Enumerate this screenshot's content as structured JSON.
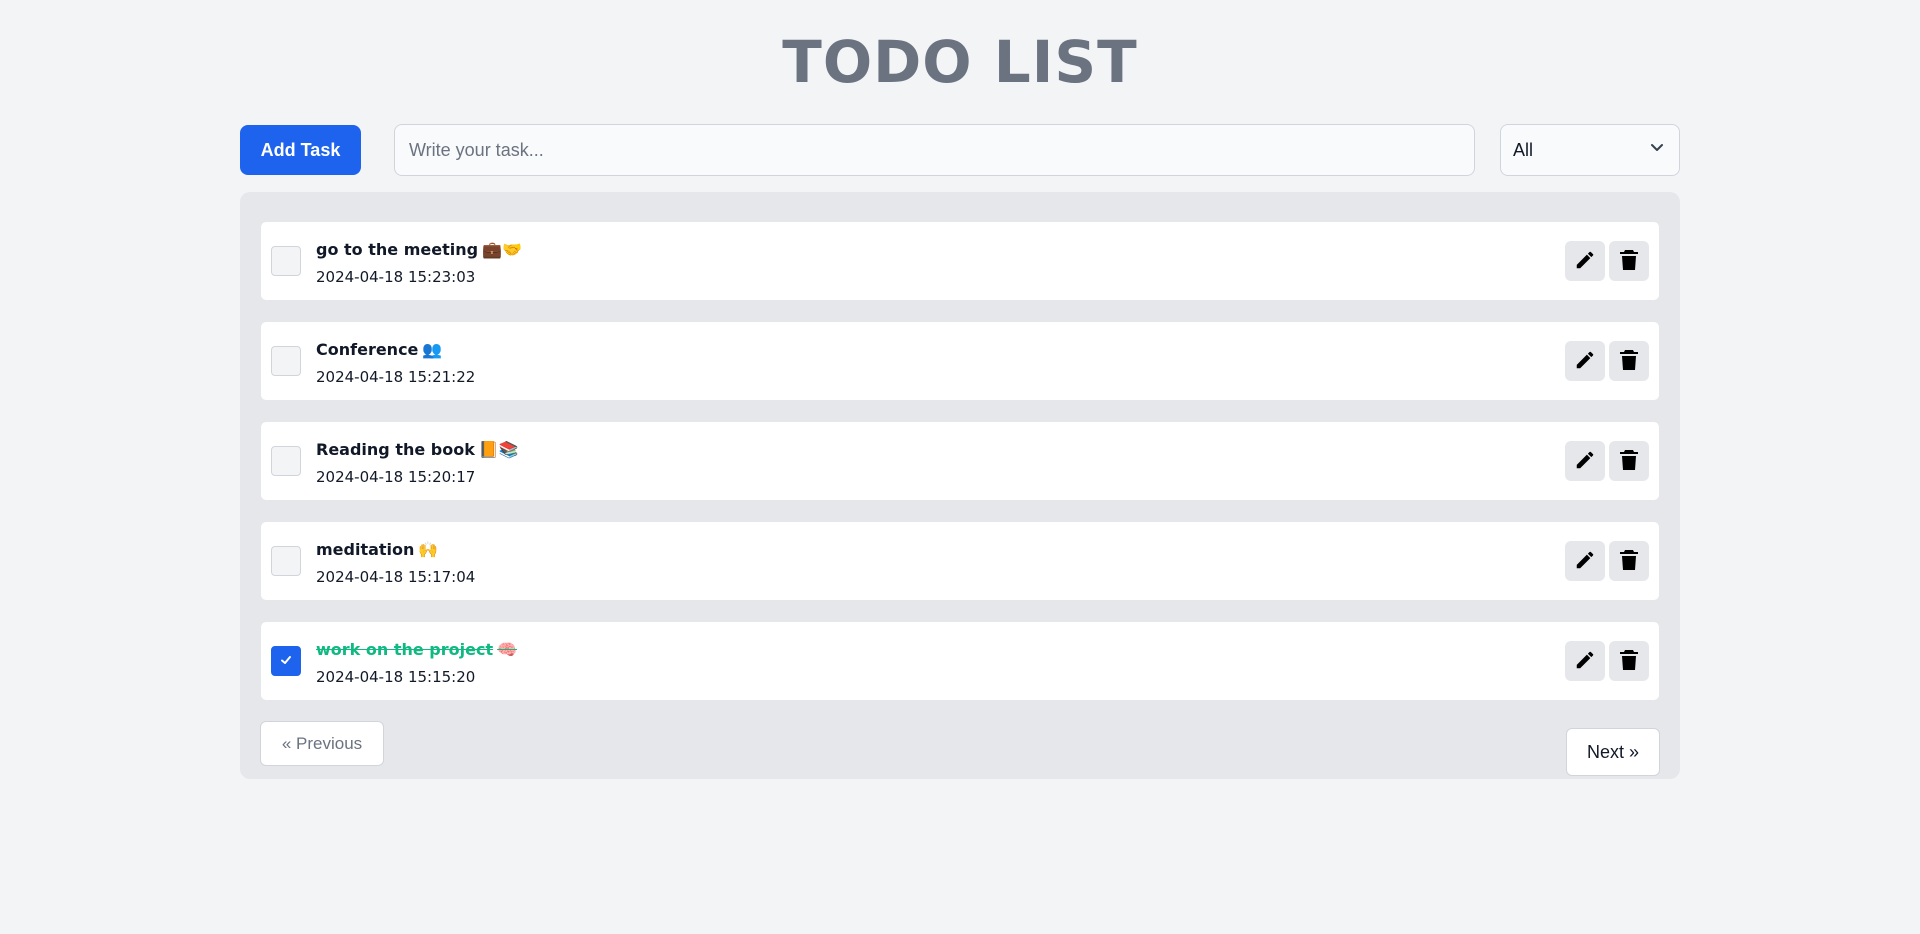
{
  "title": "TODO LIST",
  "toolbar": {
    "add_label": "Add Task",
    "input_placeholder": "Write your task...",
    "filter_value": "All"
  },
  "tasks": [
    {
      "text": "go to the meeting",
      "emoji": "💼🤝",
      "date": "2024-04-18 15:23:03",
      "done": false
    },
    {
      "text": "Conference",
      "emoji": "👥",
      "date": "2024-04-18 15:21:22",
      "done": false
    },
    {
      "text": "Reading the book",
      "emoji": "📙📚",
      "date": "2024-04-18 15:20:17",
      "done": false
    },
    {
      "text": "meditation",
      "emoji": "🙌",
      "date": "2024-04-18 15:17:04",
      "done": false
    },
    {
      "text": "work on the project",
      "emoji": "🧠",
      "date": "2024-04-18 15:15:20",
      "done": true
    }
  ],
  "pagination": {
    "prev_label": "« Previous",
    "next_label": "Next »"
  },
  "colors": {
    "accent": "#1d63ed",
    "done_text": "#10b981",
    "title": "#6b7280"
  },
  "icons": {
    "edit": "pencil-icon",
    "delete": "trash-icon",
    "check": "check-icon",
    "dropdown": "chevron-down-icon"
  }
}
